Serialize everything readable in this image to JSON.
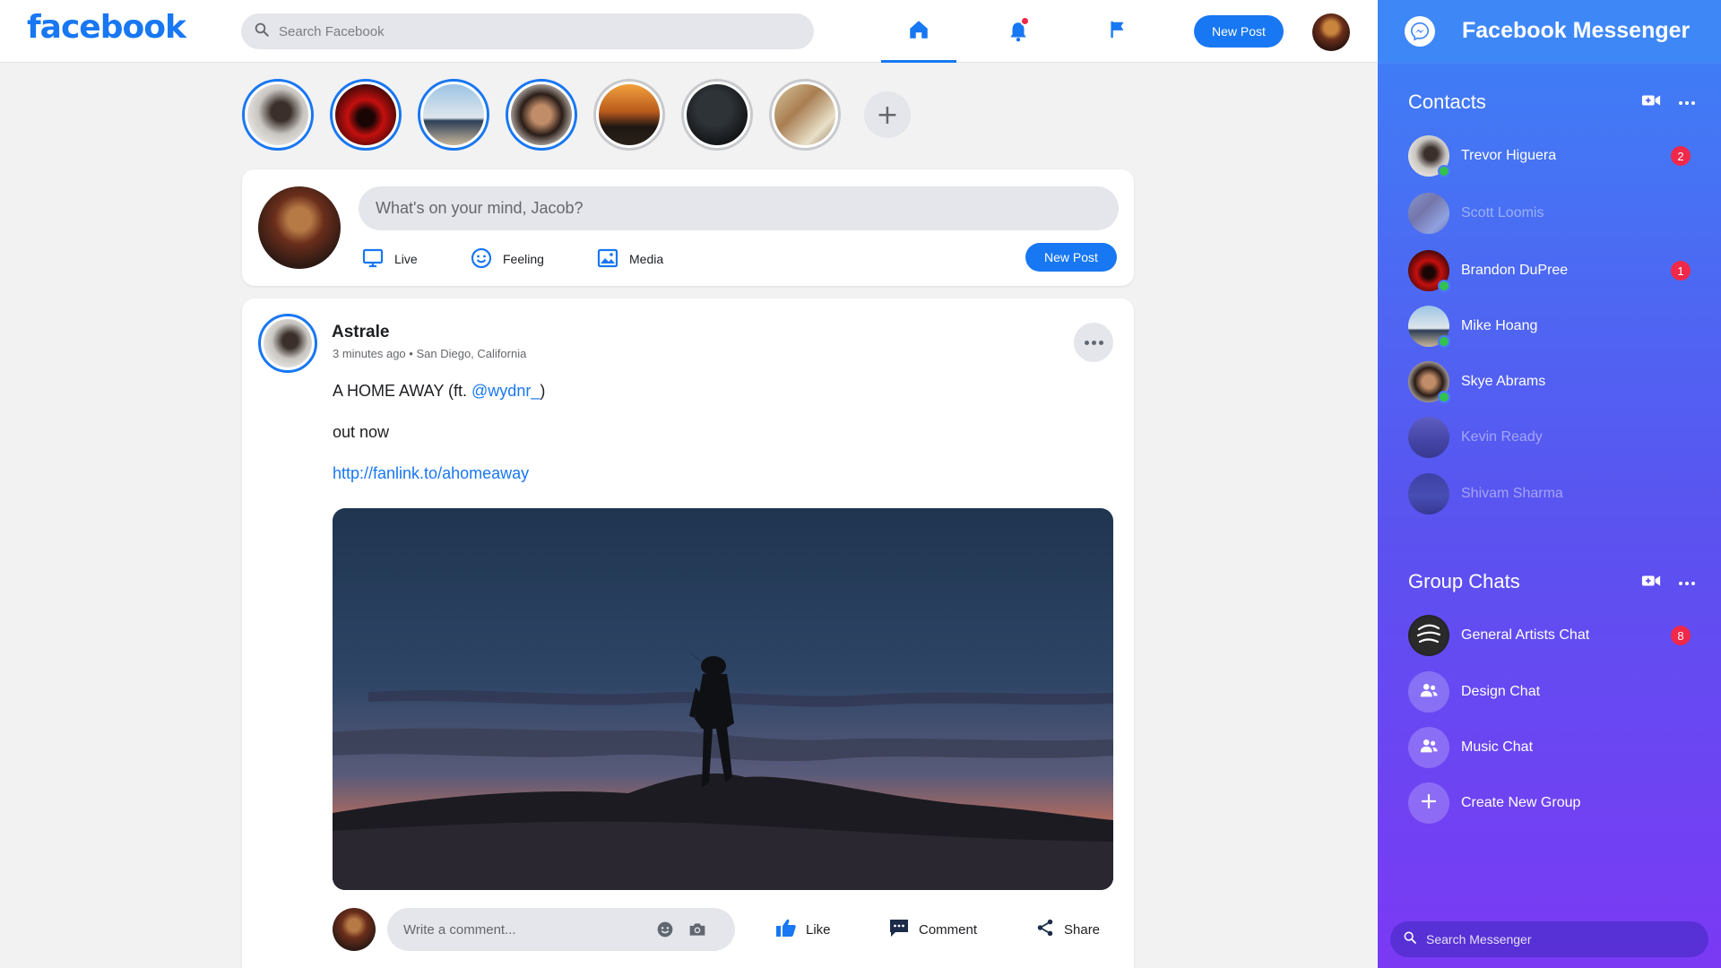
{
  "header": {
    "logo_text": "facebook",
    "search_placeholder": "Search Facebook",
    "new_post_label": "New Post",
    "icons": [
      "home-icon",
      "bell-icon",
      "flag-icon"
    ]
  },
  "stories": {
    "count": 7,
    "add_icon": "plus-icon"
  },
  "composer": {
    "placeholder": "What's on your mind, Jacob?",
    "actions": [
      {
        "label": "Live",
        "icon": "monitor-icon"
      },
      {
        "label": "Feeling",
        "icon": "smiley-icon"
      },
      {
        "label": "Media",
        "icon": "image-icon"
      }
    ],
    "post_label": "New Post"
  },
  "post": {
    "author": "Astrale",
    "time": "3 minutes ago",
    "location": "San Diego, California",
    "title_text": "A HOME AWAY (ft. ",
    "mention": "@wydnr_",
    "title_close": ")",
    "line2": "out now",
    "link": "http://fanlink.to/ahomeaway",
    "comment_placeholder": "Write a comment...",
    "actions": [
      {
        "label": "Like",
        "icon": "thumbs-up-icon"
      },
      {
        "label": "Comment",
        "icon": "comment-icon"
      },
      {
        "label": "Share",
        "icon": "share-icon"
      }
    ]
  },
  "messenger": {
    "title": "Facebook Messenger",
    "contacts_title": "Contacts",
    "contacts": [
      {
        "name": "Trevor Higuera",
        "online": true,
        "unread": "2"
      },
      {
        "name": "Scott Loomis",
        "online": false,
        "unread": ""
      },
      {
        "name": "Brandon DuPree",
        "online": true,
        "unread": "1"
      },
      {
        "name": "Mike Hoang",
        "online": true,
        "unread": ""
      },
      {
        "name": "Skye Abrams",
        "online": true,
        "unread": ""
      },
      {
        "name": "Kevin Ready",
        "online": false,
        "unread": ""
      },
      {
        "name": "Shivam Sharma",
        "online": false,
        "unread": ""
      }
    ],
    "groups_title": "Group Chats",
    "groups": [
      {
        "name": "General Artists Chat",
        "unread": "8"
      },
      {
        "name": "Design Chat",
        "unread": ""
      },
      {
        "name": "Music Chat",
        "unread": ""
      },
      {
        "name": "Create New Group",
        "unread": ""
      }
    ],
    "search_placeholder": "Search Messenger"
  },
  "colors": {
    "brand": "#1877f2",
    "badge": "#f02849",
    "online": "#31c24f",
    "messenger_top": "#3c82f6",
    "messenger_bottom": "#7b39f4"
  }
}
